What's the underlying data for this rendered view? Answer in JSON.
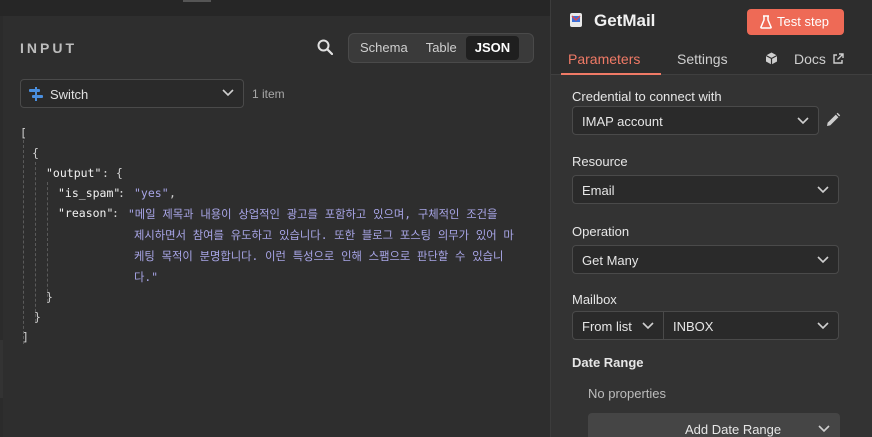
{
  "input_panel": {
    "title": "INPUT",
    "view_tabs": [
      "Schema",
      "Table",
      "JSON"
    ],
    "active_view": "JSON",
    "node_selector": {
      "value": "Switch",
      "icon": "switch-node-icon"
    },
    "item_count": "1 item",
    "json": {
      "open_bracket": "[",
      "open_brace": "{",
      "output_key": "\"output\"",
      "output_sep": ": {",
      "is_spam_key": "\"is_spam\"",
      "is_spam_value": "\"yes\"",
      "reason_key": "\"reason\"",
      "reason_lines": [
        "\"메일 제목과 내용이 상업적인 광고를 포함하고 있으며, 구체적인 조건을",
        "제시하면서 참여를 유도하고 있습니다. 또한 블로그 포스팅 의무가 있어 마",
        "케팅 목적이 분명합니다. 이런 특성으로 인해 스팸으로 판단할 수 있습니",
        "다.\""
      ],
      "close_inner": "}",
      "close_outer": "}",
      "close_bracket": "]"
    }
  },
  "node_panel": {
    "title": "GetMail",
    "test_button": "Test step",
    "tabs": {
      "parameters": "Parameters",
      "settings": "Settings",
      "docs": "Docs"
    },
    "credential": {
      "label": "Credential to connect with",
      "value": "IMAP account"
    },
    "resource": {
      "label": "Resource",
      "value": "Email"
    },
    "operation": {
      "label": "Operation",
      "value": "Get Many"
    },
    "mailbox": {
      "label": "Mailbox",
      "mode": "From list",
      "value": "INBOX"
    },
    "date_range": {
      "label": "Date Range",
      "empty_text": "No properties",
      "add_button": "Add Date Range"
    },
    "accent_color": "#ee6a56"
  }
}
